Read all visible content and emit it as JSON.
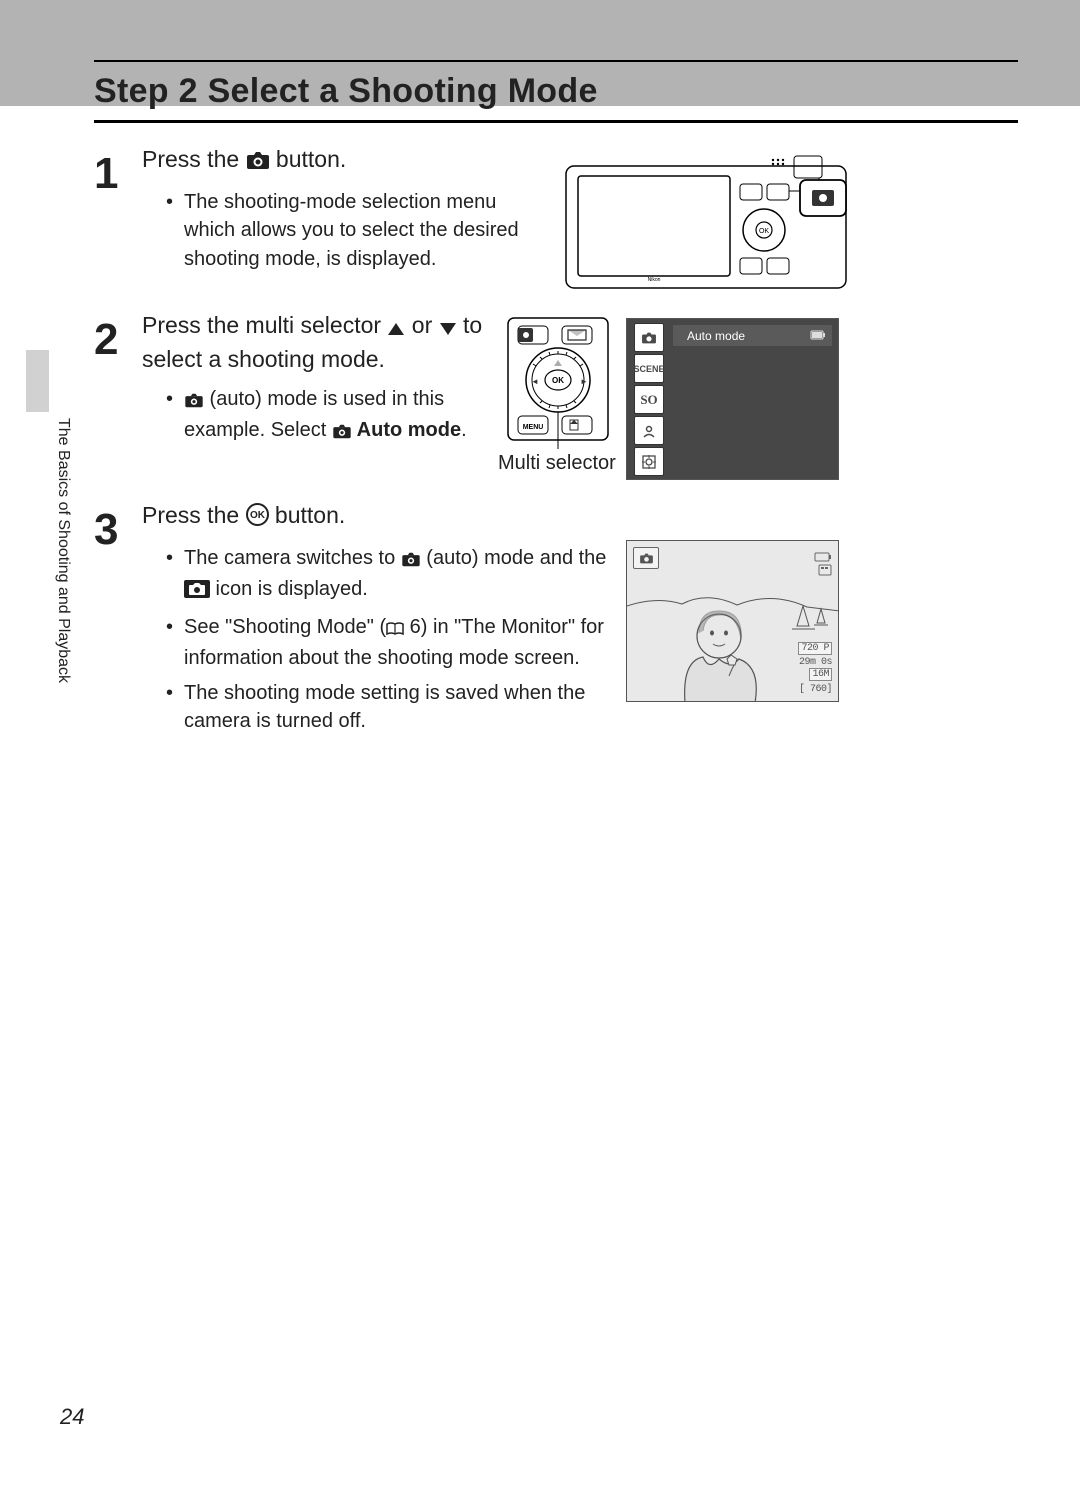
{
  "title": "Step 2 Select a Shooting Mode",
  "side_label": "The Basics of Shooting and Playback",
  "page_number": "24",
  "steps": {
    "one": {
      "num": "1",
      "head_pre": "Press the ",
      "head_post": " button.",
      "bullet1": "The shooting-mode selection menu which allows you to select the desired shooting mode, is displayed."
    },
    "two": {
      "num": "2",
      "head_a": "Press the multi selector ",
      "head_b": " or ",
      "head_c": " to select a shooting mode.",
      "bullet_pre": " (auto) mode is used in this example. Select ",
      "bullet_bold": " Auto mode",
      "bullet_post": "."
    },
    "three": {
      "num": "3",
      "head_pre": "Press the ",
      "head_post": " button.",
      "b1_a": "The camera switches to ",
      "b1_b": " (auto) mode and the ",
      "b1_c": " icon is displayed.",
      "b2_a": "See \"Shooting Mode\" (",
      "b2_b": " 6) in \"The Monitor\" for information about the shooting mode screen.",
      "b3": "The shooting mode setting is saved when the camera is turned off."
    }
  },
  "labels": {
    "multi_selector": "Multi selector",
    "auto_mode": "Auto mode",
    "so": "SO",
    "menu": "MENU"
  },
  "monitor": {
    "video": "720 P",
    "time": "29m 0s",
    "size": "16M",
    "count": "[  760]"
  }
}
